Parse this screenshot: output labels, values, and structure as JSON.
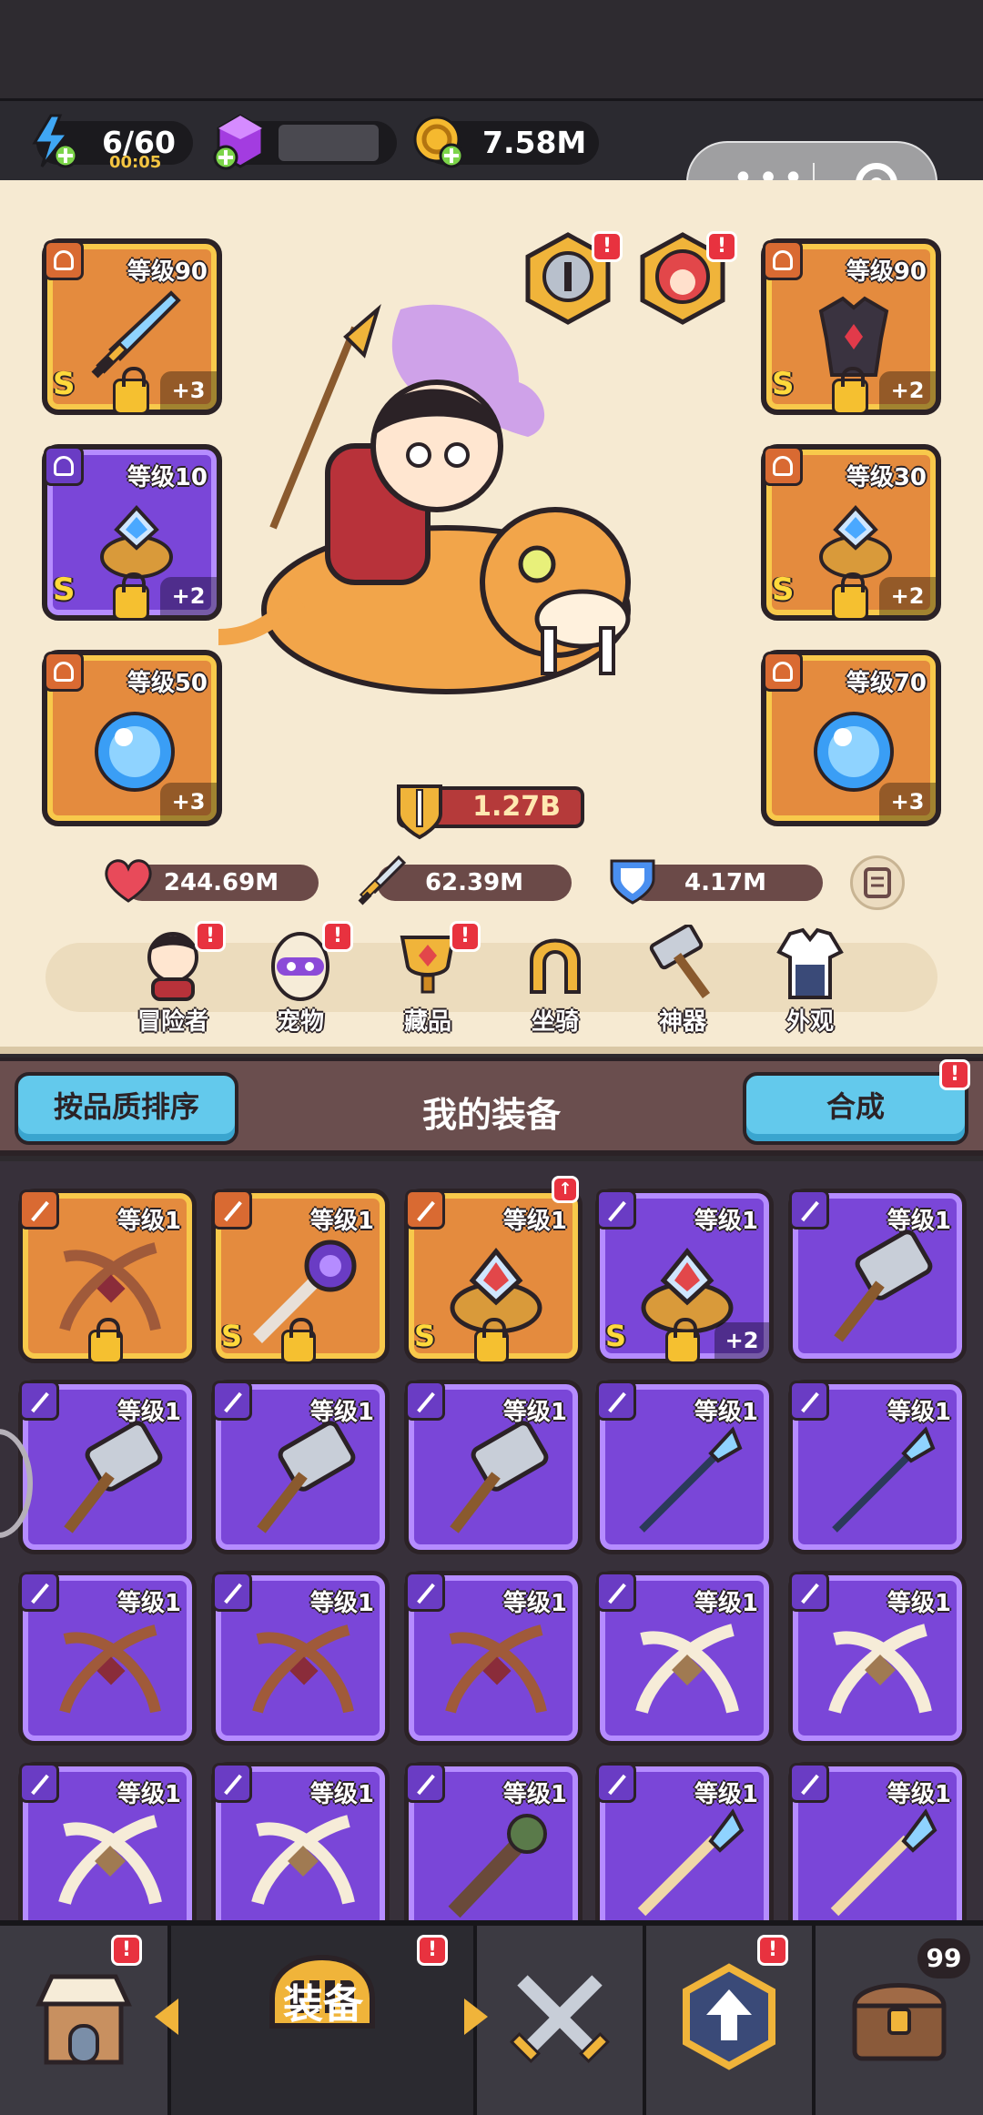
{
  "resources": {
    "energy": "6/60",
    "energy_timer": "00:05",
    "gem": "",
    "gold": "7.58M"
  },
  "equipped": [
    {
      "level": "等级90",
      "grade": "S",
      "plus": "+3"
    },
    {
      "level": "等级10",
      "grade": "S",
      "plus": "+2"
    },
    {
      "level": "等级50",
      "grade": "",
      "plus": "+3"
    },
    {
      "level": "等级90",
      "grade": "S",
      "plus": "+2"
    },
    {
      "level": "等级30",
      "grade": "S",
      "plus": "+2"
    },
    {
      "level": "等级70",
      "grade": "",
      "plus": "+3"
    }
  ],
  "power": "1.27B",
  "stats": {
    "hp": "244.69M",
    "attack": "62.39M",
    "defense": "4.17M"
  },
  "nav": [
    {
      "label": "冒险者",
      "icon": "adventurer-icon"
    },
    {
      "label": "宠物",
      "icon": "pet-egg-icon"
    },
    {
      "label": "藏品",
      "icon": "collection-trophy-icon"
    },
    {
      "label": "坐骑",
      "icon": "mount-horseshoe-icon"
    },
    {
      "label": "神器",
      "icon": "artifact-hammer-icon"
    },
    {
      "label": "外观",
      "icon": "appearance-outfit-icon"
    }
  ],
  "badge_mark": "!",
  "equipment_header": {
    "sort_label": "按品质排序",
    "title": "我的装备",
    "merge_label": "合成"
  },
  "inventory": [
    {
      "level": "等级1",
      "grade": "",
      "plus": "",
      "item": "crossbow"
    },
    {
      "level": "等级1",
      "grade": "S",
      "plus": "",
      "item": "scepter"
    },
    {
      "level": "等级1",
      "grade": "S",
      "plus": "",
      "item": "ring"
    },
    {
      "level": "等级1",
      "grade": "S",
      "plus": "+2",
      "item": "ring"
    },
    {
      "level": "等级1",
      "grade": "",
      "plus": "",
      "item": "hammer"
    },
    {
      "level": "等级1",
      "grade": "",
      "plus": "",
      "item": "hammer"
    },
    {
      "level": "等级1",
      "grade": "",
      "plus": "",
      "item": "hammer"
    },
    {
      "level": "等级1",
      "grade": "",
      "plus": "",
      "item": "hammer"
    },
    {
      "level": "等级1",
      "grade": "",
      "plus": "",
      "item": "spear"
    },
    {
      "level": "等级1",
      "grade": "",
      "plus": "",
      "item": "spear"
    },
    {
      "level": "等级1",
      "grade": "",
      "plus": "",
      "item": "crossbow"
    },
    {
      "level": "等级1",
      "grade": "",
      "plus": "",
      "item": "crossbow"
    },
    {
      "level": "等级1",
      "grade": "",
      "plus": "",
      "item": "crossbow"
    },
    {
      "level": "等级1",
      "grade": "",
      "plus": "",
      "item": "bone-bow"
    },
    {
      "level": "等级1",
      "grade": "",
      "plus": "",
      "item": "bone-bow"
    },
    {
      "level": "等级1",
      "grade": "",
      "plus": "",
      "item": "bone-bow"
    },
    {
      "level": "等级1",
      "grade": "",
      "plus": "",
      "item": "bone-bow"
    },
    {
      "level": "等级1",
      "grade": "",
      "plus": "",
      "item": "club"
    },
    {
      "level": "等级1",
      "grade": "",
      "plus": "",
      "item": "crystal-staff"
    },
    {
      "level": "等级1",
      "grade": "",
      "plus": "",
      "item": "crystal-staff"
    }
  ],
  "bottom_tabs": {
    "equip_label": "装备",
    "chest_count": "99"
  }
}
